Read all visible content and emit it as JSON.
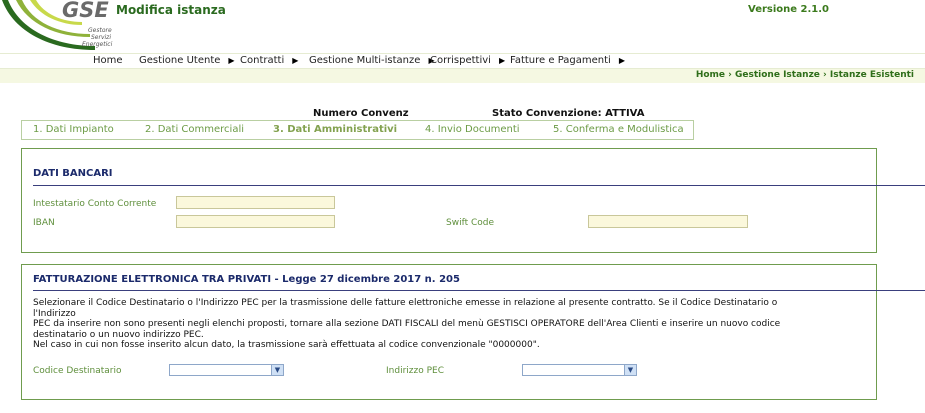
{
  "header": {
    "app_title": "Modifica istanza",
    "version": "Versione 2.1.0",
    "logo": {
      "brand": "GSE",
      "tagline_1": "Gestore",
      "tagline_2": "Servizi",
      "tagline_3": "Energetici"
    }
  },
  "nav": {
    "items": [
      {
        "label": "Home",
        "has_arrow": false
      },
      {
        "label": "Gestione Utente",
        "has_arrow": true
      },
      {
        "label": "Contratti",
        "has_arrow": true
      },
      {
        "label": "Gestione Multi-istanze",
        "has_arrow": true
      },
      {
        "label": "Corrispettivi",
        "has_arrow": true
      },
      {
        "label": "Fatture e Pagamenti",
        "has_arrow": true
      }
    ],
    "arrow_glyph": "▶"
  },
  "breadcrumb": "Home › Gestione Istanze › Istanze Esistenti",
  "info": {
    "numero_convenzione": "Numero Convenzione",
    "stato_convenzione": "Stato Convenzione: ATTIVA"
  },
  "tabs": [
    {
      "label": "1. Dati Impianto",
      "active": false
    },
    {
      "label": "2. Dati Commerciali",
      "active": false
    },
    {
      "label": "3. Dati Amministrativi",
      "active": true
    },
    {
      "label": "4. Invio Documenti",
      "active": false
    },
    {
      "label": "5. Conferma e Modulistica",
      "active": false
    }
  ],
  "dati_bancari": {
    "title": "DATI BANCARI",
    "intestatario_label": "Intestatario Conto Corrente",
    "intestatario_value": "",
    "iban_label": "IBAN",
    "iban_value": "",
    "swift_label": "Swift Code",
    "swift_value": ""
  },
  "fatturazione": {
    "title": "FATTURAZIONE ELETTRONICA TRA PRIVATI - Legge 27 dicembre 2017 n. 205",
    "paragraph_lines": [
      "Selezionare il Codice Destinatario o l'Indirizzo PEC per la trasmissione delle fatture elettroniche emesse in relazione al presente contratto. Se il Codice Destinatario o l'Indirizzo",
      "PEC da inserire non sono presenti negli elenchi proposti, tornare alla sezione DATI FISCALI del menù GESTISCI OPERATORE dell'Area Clienti e inserire un nuovo codice",
      "destinatario o un nuovo indirizzo PEC.",
      "Nel caso in cui non fosse inserito alcun dato, la trasmissione sarà effettuata al codice convenzionale \"0000000\"."
    ],
    "codice_label": "Codice Destinatario",
    "codice_value": "",
    "pec_label": "Indirizzo PEC",
    "pec_value": ""
  },
  "colors": {
    "brand_green": "#2a6a1f",
    "accent_yellow_green": "#c8d94a",
    "title_navy": "#1b2a6b"
  }
}
